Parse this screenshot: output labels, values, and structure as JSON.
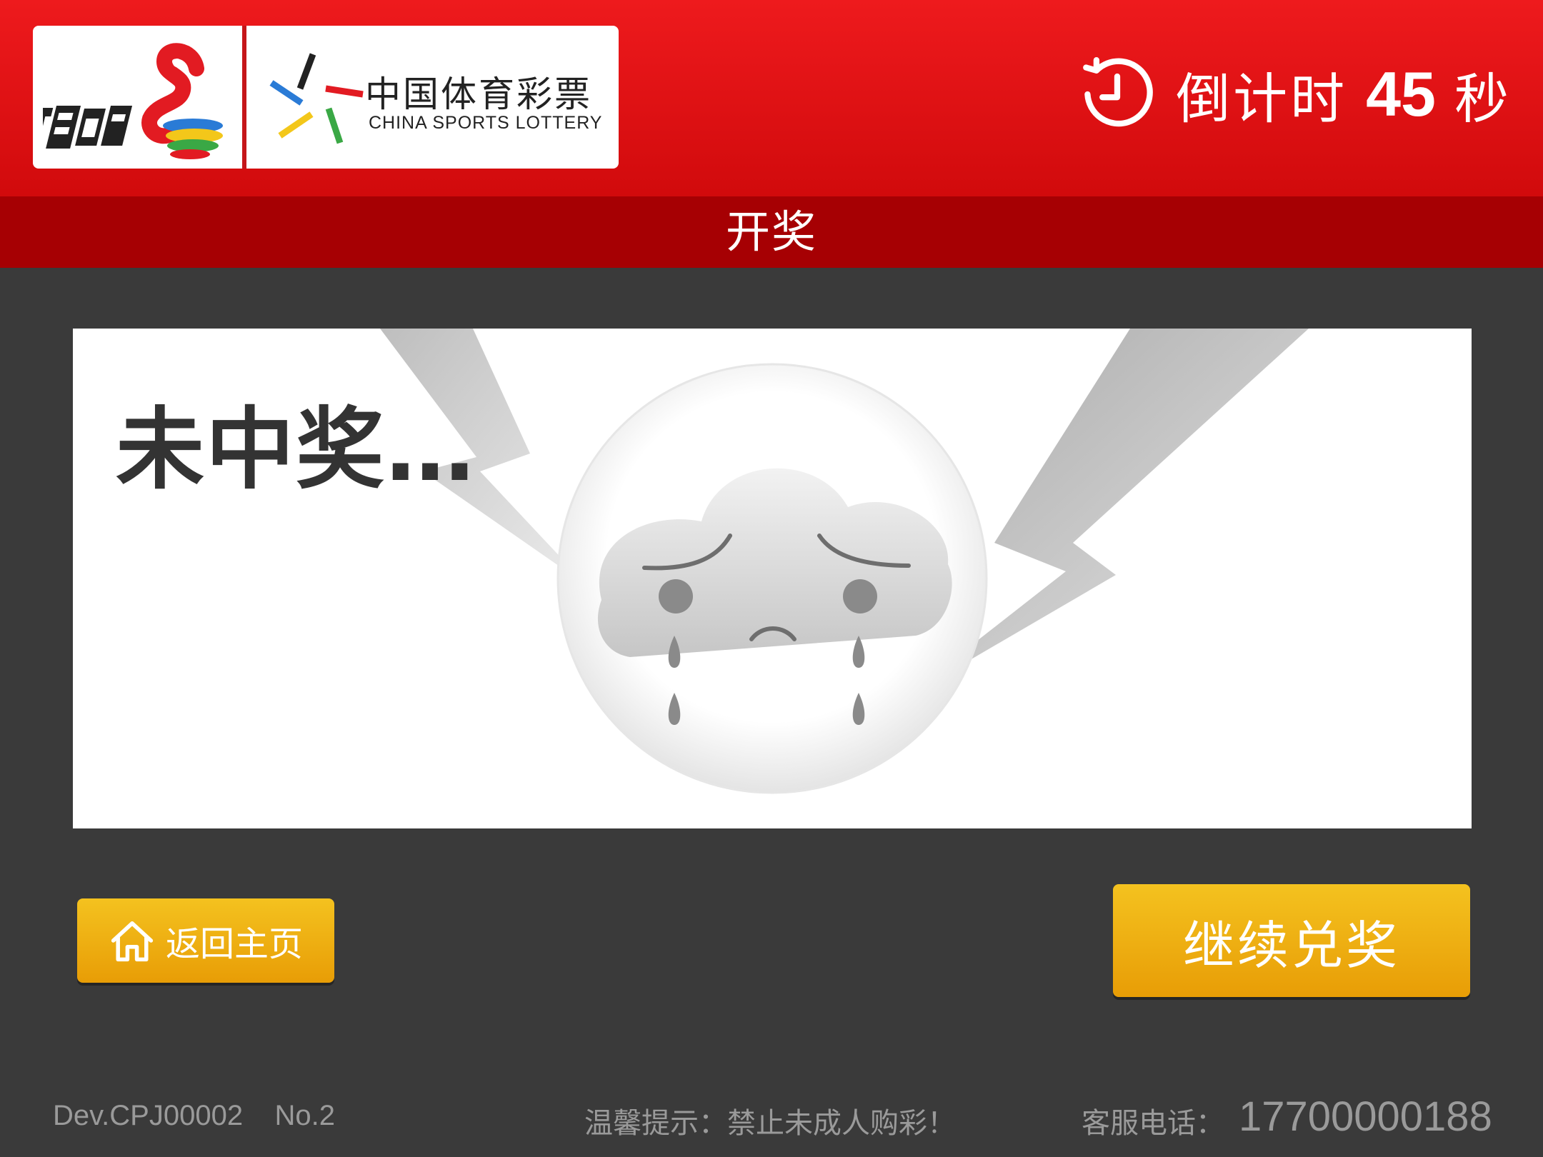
{
  "header": {
    "brand_left_alt": "顶呱刮",
    "brand_cn": "中国体育彩票",
    "brand_en": "CHINA SPORTS LOTTERY",
    "countdown": {
      "label": "倒计时",
      "seconds": "45",
      "unit": "秒",
      "icon": "clock-countdown-icon"
    }
  },
  "subbar": {
    "title": "开奖"
  },
  "result": {
    "title": "未中奖…",
    "illustration": "sad-cloud-icon"
  },
  "buttons": {
    "home_label": "返回主页",
    "home_icon": "home-icon",
    "continue_label": "继续兑奖"
  },
  "footer": {
    "device": "Dev.CPJ00002    No.2",
    "tip": "温馨提示：禁止未成人购彩！",
    "service_label": "客服电话：",
    "phone": "17700000188"
  },
  "colors": {
    "header_red": "#e11215",
    "subbar_red": "#a60003",
    "background": "#3a3a3a",
    "button_gold": "#f0b010"
  }
}
